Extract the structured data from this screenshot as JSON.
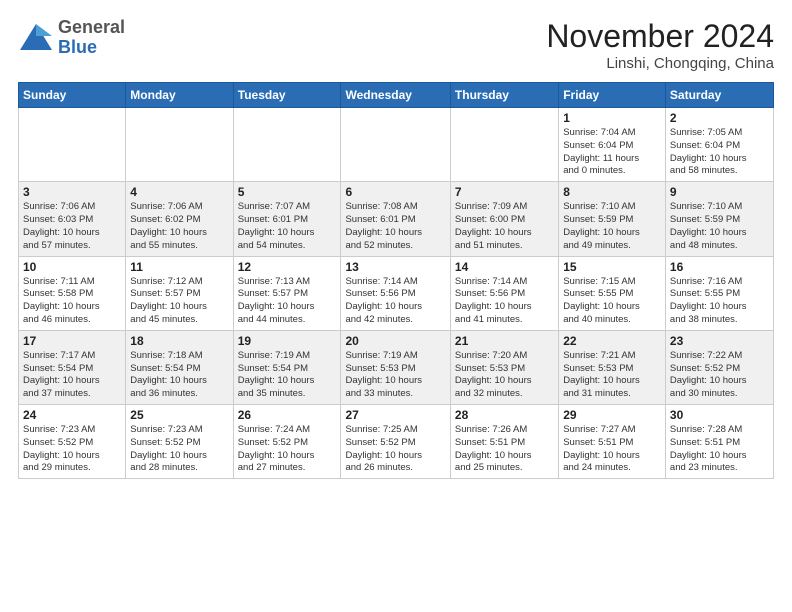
{
  "header": {
    "logo_general": "General",
    "logo_blue": "Blue",
    "month_title": "November 2024",
    "location": "Linshi, Chongqing, China"
  },
  "weekdays": [
    "Sunday",
    "Monday",
    "Tuesday",
    "Wednesday",
    "Thursday",
    "Friday",
    "Saturday"
  ],
  "rows": [
    [
      {
        "day": "",
        "info": ""
      },
      {
        "day": "",
        "info": ""
      },
      {
        "day": "",
        "info": ""
      },
      {
        "day": "",
        "info": ""
      },
      {
        "day": "",
        "info": ""
      },
      {
        "day": "1",
        "info": "Sunrise: 7:04 AM\nSunset: 6:04 PM\nDaylight: 11 hours\nand 0 minutes."
      },
      {
        "day": "2",
        "info": "Sunrise: 7:05 AM\nSunset: 6:04 PM\nDaylight: 10 hours\nand 58 minutes."
      }
    ],
    [
      {
        "day": "3",
        "info": "Sunrise: 7:06 AM\nSunset: 6:03 PM\nDaylight: 10 hours\nand 57 minutes."
      },
      {
        "day": "4",
        "info": "Sunrise: 7:06 AM\nSunset: 6:02 PM\nDaylight: 10 hours\nand 55 minutes."
      },
      {
        "day": "5",
        "info": "Sunrise: 7:07 AM\nSunset: 6:01 PM\nDaylight: 10 hours\nand 54 minutes."
      },
      {
        "day": "6",
        "info": "Sunrise: 7:08 AM\nSunset: 6:01 PM\nDaylight: 10 hours\nand 52 minutes."
      },
      {
        "day": "7",
        "info": "Sunrise: 7:09 AM\nSunset: 6:00 PM\nDaylight: 10 hours\nand 51 minutes."
      },
      {
        "day": "8",
        "info": "Sunrise: 7:10 AM\nSunset: 5:59 PM\nDaylight: 10 hours\nand 49 minutes."
      },
      {
        "day": "9",
        "info": "Sunrise: 7:10 AM\nSunset: 5:59 PM\nDaylight: 10 hours\nand 48 minutes."
      }
    ],
    [
      {
        "day": "10",
        "info": "Sunrise: 7:11 AM\nSunset: 5:58 PM\nDaylight: 10 hours\nand 46 minutes."
      },
      {
        "day": "11",
        "info": "Sunrise: 7:12 AM\nSunset: 5:57 PM\nDaylight: 10 hours\nand 45 minutes."
      },
      {
        "day": "12",
        "info": "Sunrise: 7:13 AM\nSunset: 5:57 PM\nDaylight: 10 hours\nand 44 minutes."
      },
      {
        "day": "13",
        "info": "Sunrise: 7:14 AM\nSunset: 5:56 PM\nDaylight: 10 hours\nand 42 minutes."
      },
      {
        "day": "14",
        "info": "Sunrise: 7:14 AM\nSunset: 5:56 PM\nDaylight: 10 hours\nand 41 minutes."
      },
      {
        "day": "15",
        "info": "Sunrise: 7:15 AM\nSunset: 5:55 PM\nDaylight: 10 hours\nand 40 minutes."
      },
      {
        "day": "16",
        "info": "Sunrise: 7:16 AM\nSunset: 5:55 PM\nDaylight: 10 hours\nand 38 minutes."
      }
    ],
    [
      {
        "day": "17",
        "info": "Sunrise: 7:17 AM\nSunset: 5:54 PM\nDaylight: 10 hours\nand 37 minutes."
      },
      {
        "day": "18",
        "info": "Sunrise: 7:18 AM\nSunset: 5:54 PM\nDaylight: 10 hours\nand 36 minutes."
      },
      {
        "day": "19",
        "info": "Sunrise: 7:19 AM\nSunset: 5:54 PM\nDaylight: 10 hours\nand 35 minutes."
      },
      {
        "day": "20",
        "info": "Sunrise: 7:19 AM\nSunset: 5:53 PM\nDaylight: 10 hours\nand 33 minutes."
      },
      {
        "day": "21",
        "info": "Sunrise: 7:20 AM\nSunset: 5:53 PM\nDaylight: 10 hours\nand 32 minutes."
      },
      {
        "day": "22",
        "info": "Sunrise: 7:21 AM\nSunset: 5:53 PM\nDaylight: 10 hours\nand 31 minutes."
      },
      {
        "day": "23",
        "info": "Sunrise: 7:22 AM\nSunset: 5:52 PM\nDaylight: 10 hours\nand 30 minutes."
      }
    ],
    [
      {
        "day": "24",
        "info": "Sunrise: 7:23 AM\nSunset: 5:52 PM\nDaylight: 10 hours\nand 29 minutes."
      },
      {
        "day": "25",
        "info": "Sunrise: 7:23 AM\nSunset: 5:52 PM\nDaylight: 10 hours\nand 28 minutes."
      },
      {
        "day": "26",
        "info": "Sunrise: 7:24 AM\nSunset: 5:52 PM\nDaylight: 10 hours\nand 27 minutes."
      },
      {
        "day": "27",
        "info": "Sunrise: 7:25 AM\nSunset: 5:52 PM\nDaylight: 10 hours\nand 26 minutes."
      },
      {
        "day": "28",
        "info": "Sunrise: 7:26 AM\nSunset: 5:51 PM\nDaylight: 10 hours\nand 25 minutes."
      },
      {
        "day": "29",
        "info": "Sunrise: 7:27 AM\nSunset: 5:51 PM\nDaylight: 10 hours\nand 24 minutes."
      },
      {
        "day": "30",
        "info": "Sunrise: 7:28 AM\nSunset: 5:51 PM\nDaylight: 10 hours\nand 23 minutes."
      }
    ]
  ]
}
